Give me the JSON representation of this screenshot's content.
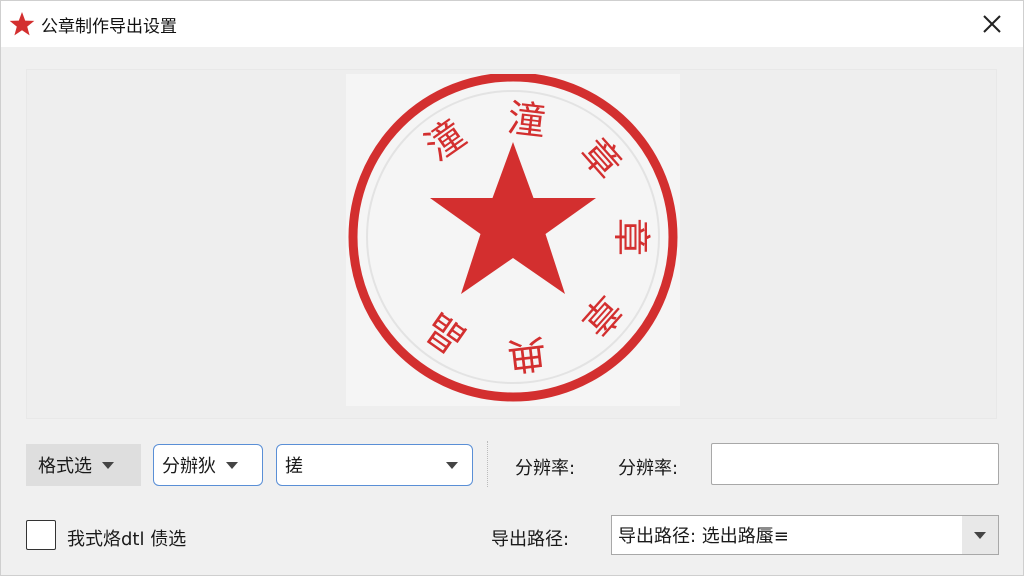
{
  "window": {
    "title": "公章制作导出设置",
    "app_icon": "red-star-icon",
    "close_icon": "close-icon"
  },
  "preview": {
    "seal": {
      "color": "#d32f2f",
      "center_icon": "star-icon",
      "text_chars": [
        "潼",
        "潼",
        "章",
        "章",
        "章",
        "典",
        "晶"
      ]
    }
  },
  "controls": {
    "format_button_label": "格式选",
    "resolution_dropdown_label": "分辦狄",
    "blank_dropdown_label": "搓",
    "resolution_label_1": "分辨率:",
    "resolution_label_2": "分辨率:",
    "resolution_input_value": "",
    "checkbox_label": "我式烙dtl 债选",
    "export_path_label": "导出路径:",
    "export_path_value": "导出路径: 选出路蜃≡"
  },
  "colors": {
    "accent_border": "#5a8fd6",
    "seal_red": "#d32f2f"
  }
}
